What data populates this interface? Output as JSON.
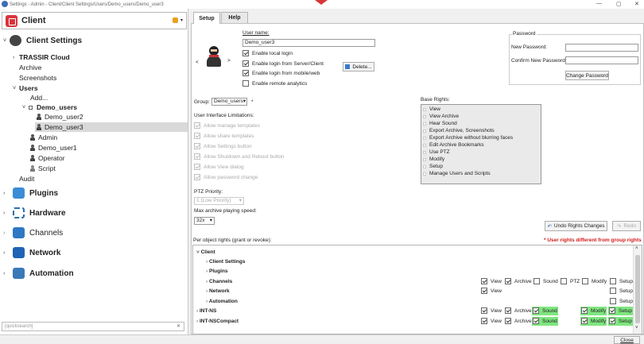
{
  "window": {
    "title": "Settings - Admin - Client/Client Settings/Users/Demo_users/Demo_user3"
  },
  "sidebar": {
    "header": "Client",
    "tree": [
      {
        "label": "Client Settings"
      },
      {
        "label": "TRASSIR Cloud"
      },
      {
        "label": "Archive"
      },
      {
        "label": "Screenshots"
      },
      {
        "label": "Users"
      },
      {
        "label": "Add..."
      },
      {
        "label": "Demo_users"
      },
      {
        "label": "Demo_user2"
      },
      {
        "label": "Demo_user3"
      },
      {
        "label": "Admin"
      },
      {
        "label": "Demo_user1"
      },
      {
        "label": "Operator"
      },
      {
        "label": "Script"
      },
      {
        "label": "Audit"
      },
      {
        "label": "Plugins"
      },
      {
        "label": "Hardware"
      },
      {
        "label": "Channels"
      },
      {
        "label": "Network"
      },
      {
        "label": "Automation"
      }
    ],
    "search_placeholder": "[quicksearch]"
  },
  "tabs": [
    {
      "label": "Setup"
    },
    {
      "label": "Help"
    }
  ],
  "user": {
    "name_label": "User name:",
    "name_value": "Demo_user3",
    "enable_local": "Enable local login",
    "enable_server": "Enable login from Server/Client",
    "enable_mobile": "Enable login from mobile/web",
    "enable_analytics": "Enable remote analytics",
    "delete_btn": "Delete...",
    "nav_prev": "<",
    "nav_next": ">"
  },
  "password": {
    "title": "Password",
    "new_label": "New Password:",
    "confirm_label": "Confirm New Password:",
    "change_btn": "Change Password"
  },
  "group": {
    "label": "Group:",
    "value": "Demo_users",
    "marker": "*"
  },
  "ui_limits": {
    "title": "User Interface Limitations:",
    "items": [
      "Allow manage templates",
      "Allow share templates",
      "Allow Settings button",
      "Allow Shutdown and Reboot button",
      "Allow View dialog",
      "Allow password change"
    ]
  },
  "ptz": {
    "label": "PTZ Priority:",
    "value": "1 (Low Priority)"
  },
  "speed": {
    "label": "Max archive playing speed:",
    "value": "32x"
  },
  "base_rights": {
    "title": "Base Rights:",
    "items": [
      "View",
      "View Archive",
      "Hear Sound",
      "Export Archive, Screenshots",
      "Export Archive without blurring faces",
      "Edit Archive Bookmarks",
      "Use PTZ",
      "Modify",
      "Setup",
      "Manage Users and Scripts"
    ]
  },
  "actions": {
    "undo": "Undo Rights Changes",
    "redo": "Redo"
  },
  "per_object": {
    "label": "Per object rights (grant or revoke):",
    "note": "* User rights different from group rights",
    "rows": [
      {
        "name": "Client"
      },
      {
        "name": "Client Settings"
      },
      {
        "name": "Plugins"
      },
      {
        "name": "Channels"
      },
      {
        "name": "Network"
      },
      {
        "name": "Automation"
      },
      {
        "name": "INT-NS"
      },
      {
        "name": "INT-NSCompact"
      }
    ],
    "col": {
      "view": "View",
      "archive": "Archive",
      "sound": "Sound",
      "ptz": "PTZ",
      "modify": "Modify",
      "setup": "Setup"
    }
  },
  "footer": {
    "close": "Close"
  }
}
